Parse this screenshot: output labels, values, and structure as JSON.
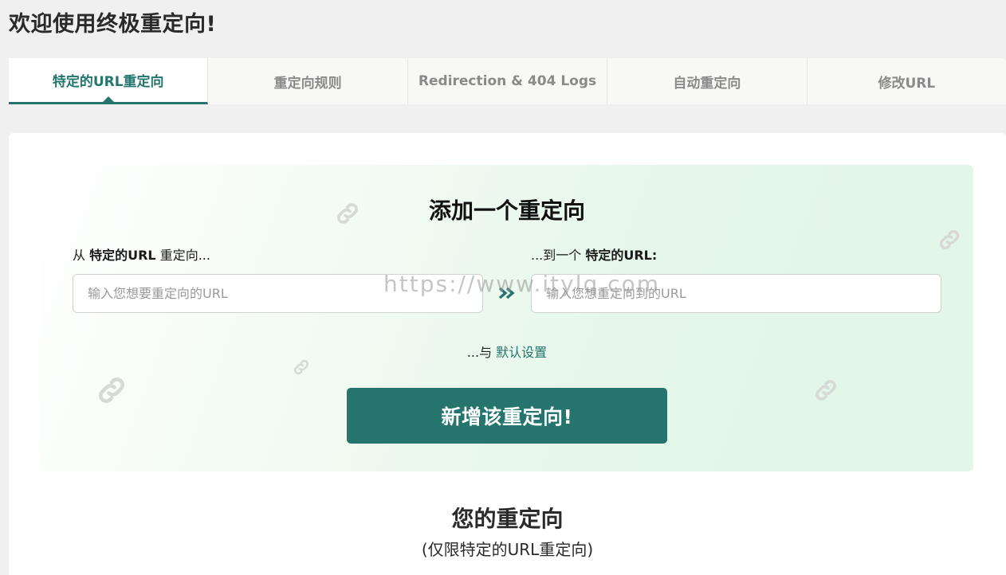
{
  "page": {
    "title": "欢迎使用终极重定向!"
  },
  "tabs": [
    {
      "label": "特定的URL重定向",
      "active": true
    },
    {
      "label": "重定向规则",
      "active": false
    },
    {
      "label": "Redirection & 404 Logs",
      "active": false
    },
    {
      "label": "自动重定向",
      "active": false
    },
    {
      "label": "修改URL",
      "active": false
    }
  ],
  "add_redirect": {
    "title": "添加一个重定向",
    "from_label_prefix": "从 ",
    "from_label_bold": "特定的URL",
    "from_label_suffix": " 重定向...",
    "from_placeholder": "输入您想要重定向的URL",
    "to_label_prefix": "...到一个 ",
    "to_label_bold": "特定的URL:",
    "to_placeholder": "输入您想重定向到的URL",
    "defaults_prefix": "...与 ",
    "defaults_link": "默认设置",
    "submit_label": "新增该重定向!"
  },
  "watermark": "https://www.itylq.com",
  "redirects_section": {
    "title": "您的重定向",
    "subtitle": "(仅限特定的URL重定向)"
  },
  "colors": {
    "accent": "#25756e",
    "card_gradient_end": "#e3f6e7",
    "background": "#f0f0f0"
  },
  "icons": [
    "link-icon",
    "double-chevron-right-icon"
  ]
}
